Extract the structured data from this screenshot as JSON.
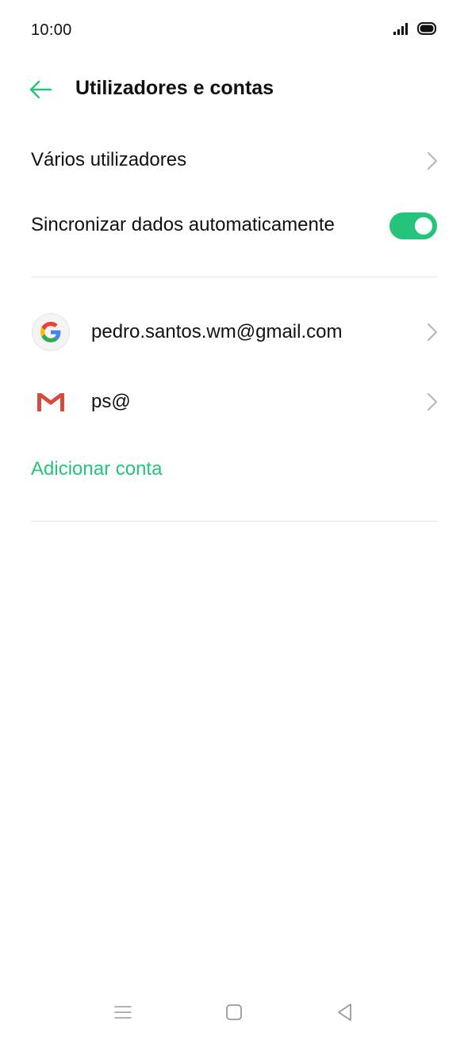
{
  "status_bar": {
    "time": "10:00",
    "icons": [
      "signal-icon",
      "battery-icon"
    ]
  },
  "app_bar": {
    "back_icon": "arrow-left-icon",
    "title": "Utilizadores e contas"
  },
  "settings": {
    "multiple_users_label": "Vários utilizadores",
    "auto_sync_label": "Sincronizar dados automaticamente",
    "auto_sync_enabled": true
  },
  "accounts": [
    {
      "icon": "google-icon",
      "label": "pedro.santos.wm@gmail.com"
    },
    {
      "icon": "gmail-icon",
      "label": "ps@"
    }
  ],
  "add_account_label": "Adicionar conta",
  "nav_bar": {
    "buttons": [
      "menu-icon",
      "home-icon",
      "back-triangle-icon"
    ]
  },
  "colors": {
    "accent": "#24c47d",
    "divider": "#e3e3e3",
    "text": "#111111",
    "chevron": "#b5b5b5"
  }
}
